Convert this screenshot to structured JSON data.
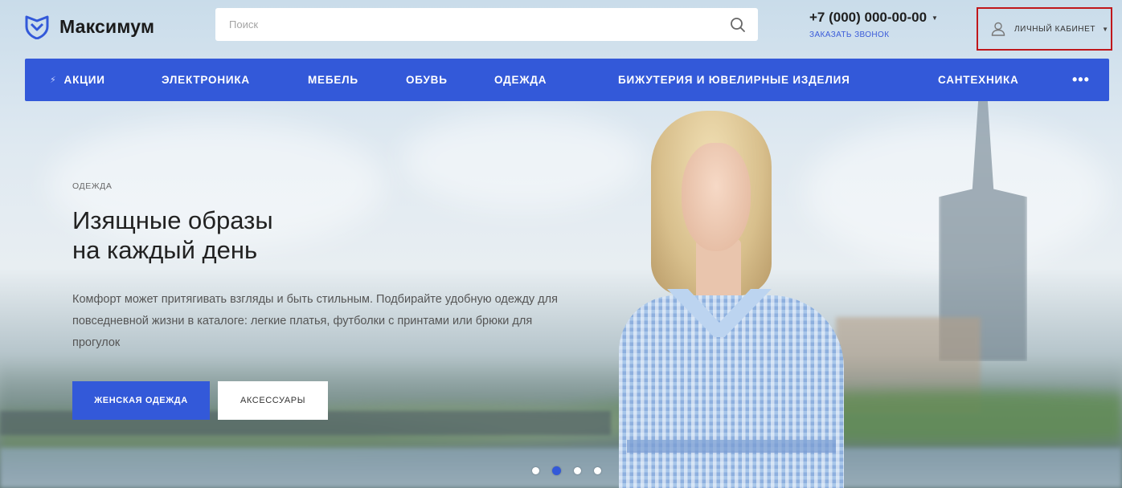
{
  "header": {
    "logo_text": "Максимум",
    "search_placeholder": "Поиск",
    "phone": "+7 (000) 000-00-00",
    "callback_link": "ЗАКАЗАТЬ ЗВОНОК",
    "cabinet_label": "ЛИЧНЫЙ КАБИНЕТ"
  },
  "nav": {
    "items": [
      {
        "label": "АКЦИИ",
        "icon": "lightning-icon"
      },
      {
        "label": "ЭЛЕКТРОНИКА"
      },
      {
        "label": "МЕБЕЛЬ"
      },
      {
        "label": "ОБУВЬ"
      },
      {
        "label": "ОДЕЖДА"
      },
      {
        "label": "БИЖУТЕРИЯ И ЮВЕЛИРНЫЕ ИЗДЕЛИЯ"
      },
      {
        "label": "САНТЕХНИКА"
      }
    ],
    "more_label": "•••"
  },
  "hero": {
    "category": "ОДЕЖДА",
    "title_line1": "Изящные образы",
    "title_line2": "на каждый день",
    "description": "Комфорт может притягивать взгляды и быть стильным. Подбирайте удобную одежду для повседневной жизни в каталоге: легкие платья, футболки с принтами или брюки для прогулок",
    "primary_button": "ЖЕНСКАЯ ОДЕЖДА",
    "secondary_button": "АКСЕССУАРЫ"
  },
  "slider": {
    "total_slides": 4,
    "active_slide": 2
  },
  "colors": {
    "accent": "#3359d9",
    "highlight_border": "#c0171b"
  }
}
